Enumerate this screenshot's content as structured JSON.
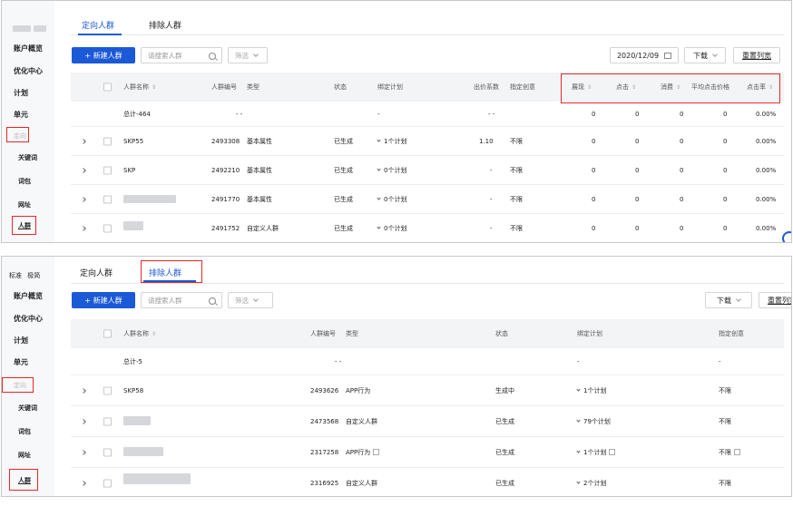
{
  "top": {
    "tabs": [
      "定向人群",
      "排除人群"
    ],
    "active_tab": 0,
    "sidebar": {
      "items": [
        "账户概览",
        "优化中心",
        "计划",
        "单元",
        "定向"
      ],
      "sub_items": [
        "关键词",
        "词包",
        "网址",
        "人群"
      ]
    },
    "toolbar": {
      "new_label": "+ 新建人群",
      "search_placeholder": "请搜索人群",
      "filter_label": "筛选",
      "date_value": "2020/12/09",
      "download_label": "下载",
      "reset_label": "重置列宽"
    },
    "columns": [
      "人群名称",
      "人群编号",
      "类型",
      "状态",
      "绑定计划",
      "出价系数",
      "指定创意",
      "展现",
      "点击",
      "消费",
      "平均点击价格",
      "点击率"
    ],
    "total_row": {
      "name": "总计-464",
      "id": "- -",
      "plan": "-",
      "bid": "- -",
      "impr": "0",
      "click": "0",
      "cost": "0",
      "cpc": "0",
      "ctr": "0.00%"
    },
    "rows": [
      {
        "name": "SKP55",
        "id": "2493308",
        "type": "基本属性",
        "status": "已生成",
        "plan": "1个计划",
        "bid": "1.10",
        "creative": "不限",
        "impr": "0",
        "click": "0",
        "cost": "0",
        "cpc": "0",
        "ctr": "0.00%"
      },
      {
        "name": "SKP",
        "id": "2492210",
        "type": "基本属性",
        "status": "已生成",
        "plan": "0个计划",
        "bid": "-",
        "creative": "不限",
        "impr": "0",
        "click": "0",
        "cost": "0",
        "cpc": "0",
        "ctr": "0.00%"
      },
      {
        "name": "",
        "id": "2491770",
        "type": "基本属性",
        "status": "已生成",
        "plan": "0个计划",
        "bid": "-",
        "creative": "不限",
        "impr": "0",
        "click": "0",
        "cost": "0",
        "cpc": "0",
        "ctr": "0.00%"
      },
      {
        "name": "",
        "id": "2491752",
        "type": "自定义人群",
        "status": "已生成",
        "plan": "0个计划",
        "bid": "-",
        "creative": "不限",
        "impr": "0",
        "click": "0",
        "cost": "0",
        "cpc": "0",
        "ctr": "0.00%"
      }
    ]
  },
  "bottom": {
    "tabs": [
      "定向人群",
      "排除人群"
    ],
    "active_tab": 1,
    "sidebar": {
      "mode_std": "标准",
      "mode_ext": "极简",
      "items": [
        "账户概览",
        "优化中心",
        "计划",
        "单元",
        "定向"
      ],
      "sub_items": [
        "关键词",
        "词包",
        "网址",
        "人群"
      ]
    },
    "toolbar": {
      "new_label": "+ 新建人群",
      "search_placeholder": "请搜索人群",
      "filter_label": "筛选",
      "download_label": "下载",
      "reset_label": "重置列宽"
    },
    "columns": [
      "人群名称",
      "人群编号",
      "类型",
      "状态",
      "绑定计划",
      "指定创意"
    ],
    "total_row": {
      "name": "总计-5",
      "id": "- -",
      "plan": "-",
      "creative": "-"
    },
    "rows": [
      {
        "name": "SKP58",
        "id": "2493626",
        "type": "APP行为",
        "status": "生成中",
        "plan": "1个计划",
        "creative": "不限"
      },
      {
        "name": "",
        "id": "2473568",
        "type": "自定义人群",
        "status": "已生成",
        "plan": "79个计划",
        "creative": "不限"
      },
      {
        "name": "",
        "id": "2317258",
        "type": "APP行为",
        "status": "已生成",
        "plan": "1个计划",
        "creative": "不限"
      },
      {
        "name": "",
        "id": "2316925",
        "type": "自定义人群",
        "status": "已生成",
        "plan": "2个计划",
        "creative": "不限"
      }
    ]
  },
  "colors": {
    "accent": "#1b59d6",
    "highlight": "#e8262a",
    "header_bg": "#f3f4f6",
    "sidebar_bg": "#f7f8fa"
  }
}
